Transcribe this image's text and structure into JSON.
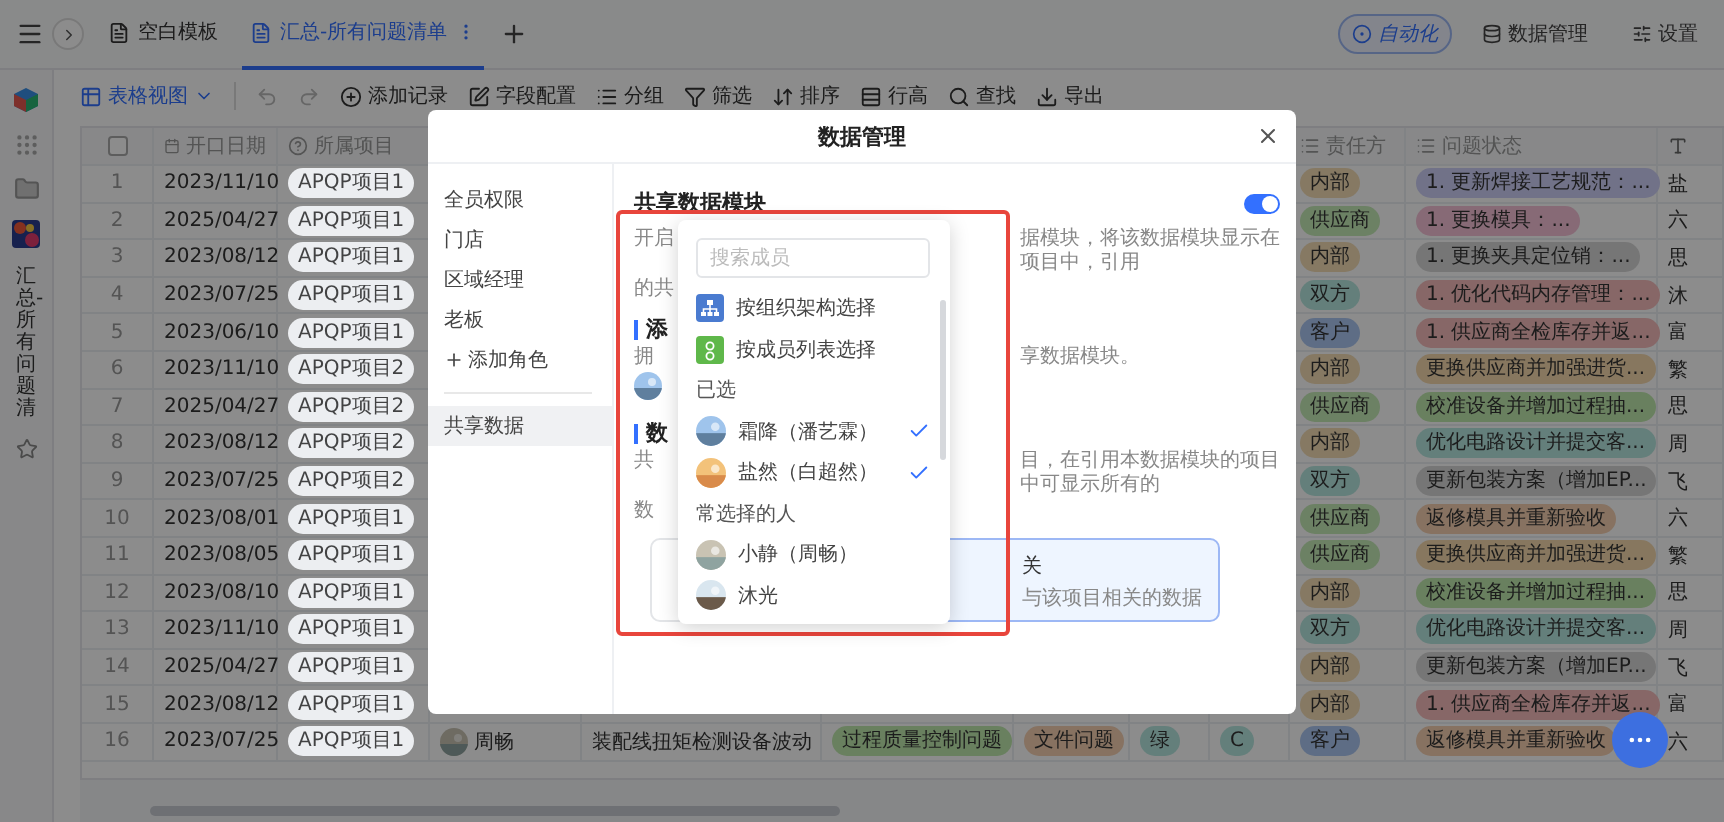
{
  "topbar": {
    "tabs": [
      {
        "label": "空白模板",
        "selected": false
      },
      {
        "label": "汇总-所有问题清单",
        "selected": true
      }
    ],
    "actions": [
      {
        "label": "自动化",
        "kind": "pill"
      },
      {
        "label": "数据管理",
        "kind": "plain"
      },
      {
        "label": "设置",
        "kind": "plain"
      }
    ]
  },
  "sidebar": {
    "vertical_title": "汇总-所有问题清"
  },
  "toolbar": {
    "view": "表格视图",
    "actions": [
      "添加记录",
      "字段配置",
      "分组",
      "筛选",
      "排序",
      "行高",
      "查找",
      "导出"
    ]
  },
  "table": {
    "select_all": {
      "checked": false
    },
    "columns": [
      {
        "label": "开口日期"
      },
      {
        "label": "所属项目"
      },
      {
        "label": "责任方"
      },
      {
        "label": "问题状态"
      }
    ],
    "rows": [
      {
        "index": "1",
        "date": "2023/11/10",
        "project": "APQP项目1",
        "owner": {
          "text": "内部",
          "color": "#867963"
        },
        "status": {
          "text": "1. 更新焊接工艺规范：...",
          "color": "#717288"
        },
        "column_12": "盐"
      },
      {
        "index": "2",
        "date": "2025/04/27",
        "project": "APQP项目1",
        "owner": {
          "text": "供应商",
          "color": "#6c8164"
        },
        "status": {
          "text": "1. 更换模具：...",
          "color": "#876a76"
        },
        "column_12": "六"
      },
      {
        "index": "3",
        "date": "2023/08/12",
        "project": "APQP项目1",
        "owner": {
          "text": "内部",
          "color": "#867963"
        },
        "status": {
          "text": "1. 更换夹具定位销：...",
          "color": "#767676"
        },
        "column_12": "思"
      },
      {
        "index": "4",
        "date": "2023/07/25",
        "project": "APQP项目1",
        "owner": {
          "text": "双方",
          "color": "#647f7b"
        },
        "status": {
          "text": "1. 优化代码内存管理：...",
          "color": "#876767"
        },
        "column_12": "沐"
      },
      {
        "index": "5",
        "date": "2023/06/10",
        "project": "APQP项目1",
        "owner": {
          "text": "客户",
          "color": "#5e6d85"
        },
        "status": {
          "text": "1. 供应商全检库存并返...",
          "color": "#876767"
        },
        "column_12": "富"
      },
      {
        "index": "6",
        "date": "2023/11/10",
        "project": "APQP项目2",
        "owner": {
          "text": "内部",
          "color": "#867963"
        },
        "status": {
          "text": "更换供应商并加强进货...",
          "color": "#87775f"
        },
        "column_12": "繁"
      },
      {
        "index": "7",
        "date": "2025/04/27",
        "project": "APQP项目2",
        "owner": {
          "text": "供应商",
          "color": "#6c8164"
        },
        "status": {
          "text": "校准设备并增加过程抽...",
          "color": "#69805f"
        },
        "column_12": "思"
      },
      {
        "index": "8",
        "date": "2023/08/12",
        "project": "APQP项目2",
        "owner": {
          "text": "内部",
          "color": "#867963"
        },
        "status": {
          "text": "优化电路设计并提交客...",
          "color": "#647f7b"
        },
        "column_12": "周"
      },
      {
        "index": "9",
        "date": "2023/07/25",
        "project": "APQP项目2",
        "owner": {
          "text": "双方",
          "color": "#647f7b"
        },
        "status": {
          "text": "更新包装方案（增加EP...",
          "color": "#767676"
        },
        "column_12": "飞"
      },
      {
        "index": "10",
        "date": "2023/08/01",
        "project": "APQP项目1",
        "owner": {
          "text": "供应商",
          "color": "#6c8164"
        },
        "status": {
          "text": "返修模具并重新验收",
          "color": "#877261"
        },
        "column_12": "六"
      },
      {
        "index": "11",
        "date": "2023/08/05",
        "project": "APQP项目1",
        "owner": {
          "text": "供应商",
          "color": "#6c8164"
        },
        "status": {
          "text": "更换供应商并加强进货...",
          "color": "#87775f"
        },
        "column_12": "繁"
      },
      {
        "index": "12",
        "date": "2023/08/10",
        "project": "APQP项目1",
        "owner": {
          "text": "内部",
          "color": "#867963"
        },
        "status": {
          "text": "校准设备并增加过程抽...",
          "color": "#69805f"
        },
        "column_12": "思"
      },
      {
        "index": "13",
        "date": "2023/11/10",
        "project": "APQP项目1",
        "owner": {
          "text": "双方",
          "color": "#647f7b"
        },
        "status": {
          "text": "优化电路设计并提交客...",
          "color": "#647f7b"
        },
        "column_12": "周"
      },
      {
        "index": "14",
        "date": "2025/04/27",
        "project": "APQP项目1",
        "owner": {
          "text": "内部",
          "color": "#867963"
        },
        "status": {
          "text": "更新包装方案（增加EP...",
          "color": "#767676"
        },
        "column_12": "飞"
      },
      {
        "index": "15",
        "date": "2023/08/12",
        "project": "APQP项目1",
        "owner": {
          "text": "内部",
          "color": "#867963"
        },
        "status": {
          "text": "1. 供应商全检库存并返...",
          "color": "#876767"
        },
        "column_12": "富"
      },
      {
        "index": "16",
        "date": "2023/07/25",
        "project": "APQP项目1",
        "column_4": {
          "name": "周畅"
        },
        "column_5": "装配线扭矩检测设备波动",
        "column_6": {
          "text": "过程质量控制问题",
          "color": "#69805f"
        },
        "column_7": {
          "text": "文件问题",
          "color": "#877261"
        },
        "column_8": {
          "text": "绿",
          "color": "#647f7b"
        },
        "column_9": {
          "text": "C",
          "color": "#647f7b"
        },
        "owner": {
          "text": "客户",
          "color": "#5e6d85"
        },
        "status": {
          "text": "返修模具并重新验收",
          "color": "#877261"
        },
        "column_12": "六"
      }
    ]
  },
  "modal": {
    "title": "数据管理",
    "nav": [
      {
        "label": "全员权限",
        "selected": false
      },
      {
        "label": "门店",
        "selected": false
      },
      {
        "label": "区域经理",
        "selected": false
      },
      {
        "label": "老板",
        "selected": false
      },
      {
        "label": "共享数据",
        "selected": true
      }
    ],
    "add_role": "添加角色",
    "content": {
      "title": "共享数据模块",
      "enabled": true,
      "lines": [
        {
          "kind": "text",
          "left": "开启",
          "right": "据模块，将该数据模块显示在项目中，引用"
        },
        {
          "kind": "text",
          "left": "的共"
        },
        {
          "kind": "heading",
          "left": "添"
        },
        {
          "kind": "text",
          "left": "拥",
          "right": "享数据模块。"
        },
        {
          "kind": "avatar"
        },
        {
          "kind": "heading",
          "left": "数"
        },
        {
          "kind": "text",
          "left": "共",
          "right": "目，在引用本数据模块的项目中可显示所有的"
        },
        {
          "kind": "text",
          "left": "数"
        }
      ],
      "cards": [
        {
          "selected": false
        },
        {
          "selected": true,
          "title": "关",
          "desc": "与该项目相关的数据"
        }
      ]
    },
    "popover": {
      "placeholder": "搜索成员",
      "options": [
        "按组织架构选择",
        "按成员列表选择"
      ],
      "groups": [
        {
          "label": "已选",
          "members": [
            {
              "name": "霜降（潘艺霖）",
              "selected": true
            },
            {
              "name": "盐然（白超然）",
              "selected": true
            }
          ]
        },
        {
          "label": "常选择的人",
          "members": [
            {
              "name": "小静（周畅）",
              "selected": false
            },
            {
              "name": "沐光",
              "selected": false
            }
          ]
        }
      ]
    }
  }
}
